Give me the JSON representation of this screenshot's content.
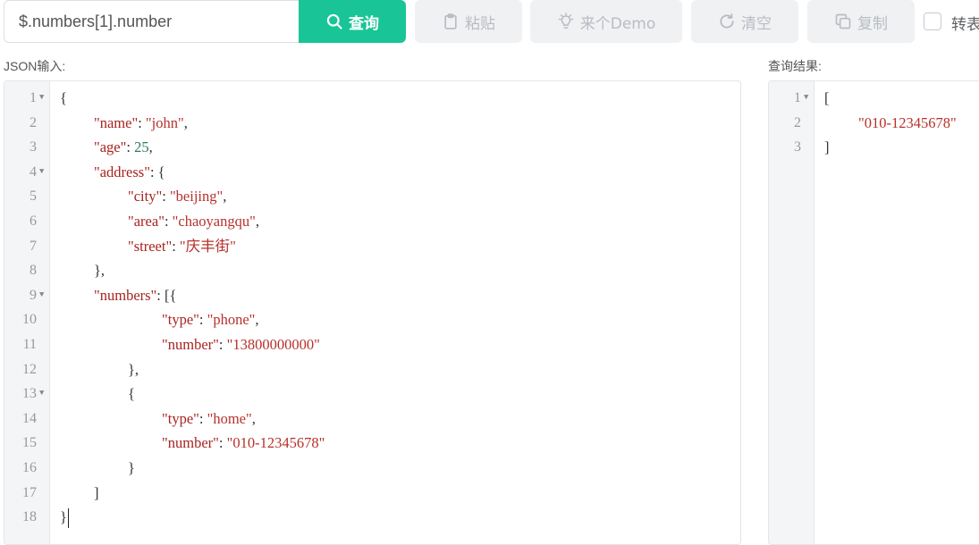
{
  "toolbar": {
    "query_value": "$.numbers[1].number",
    "query_button": "查询",
    "paste_button": "粘贴",
    "demo_button": "来个Demo",
    "clear_button": "清空",
    "copy_button": "复制",
    "escape_label": "转表",
    "escape_checked": false
  },
  "input_panel": {
    "label": "JSON输入:",
    "lines": [
      {
        "n": "1",
        "fold": true,
        "indent": 0,
        "tokens": [
          [
            "p",
            "{"
          ]
        ]
      },
      {
        "n": "2",
        "fold": false,
        "indent": 1,
        "tokens": [
          [
            "k",
            "\"name\""
          ],
          [
            "p",
            ": "
          ],
          [
            "s",
            "\"john\""
          ],
          [
            "p",
            ","
          ]
        ]
      },
      {
        "n": "3",
        "fold": false,
        "indent": 1,
        "tokens": [
          [
            "k",
            "\"age\""
          ],
          [
            "p",
            ": "
          ],
          [
            "n",
            "25"
          ],
          [
            "p",
            ","
          ]
        ]
      },
      {
        "n": "4",
        "fold": true,
        "indent": 1,
        "tokens": [
          [
            "k",
            "\"address\""
          ],
          [
            "p",
            ": {"
          ]
        ]
      },
      {
        "n": "5",
        "fold": false,
        "indent": 2,
        "tokens": [
          [
            "k",
            "\"city\""
          ],
          [
            "p",
            ": "
          ],
          [
            "s",
            "\"beijing\""
          ],
          [
            "p",
            ","
          ]
        ]
      },
      {
        "n": "6",
        "fold": false,
        "indent": 2,
        "tokens": [
          [
            "k",
            "\"area\""
          ],
          [
            "p",
            ": "
          ],
          [
            "s",
            "\"chaoyangqu\""
          ],
          [
            "p",
            ","
          ]
        ]
      },
      {
        "n": "7",
        "fold": false,
        "indent": 2,
        "tokens": [
          [
            "k",
            "\"street\""
          ],
          [
            "p",
            ": "
          ],
          [
            "s",
            "\"庆丰街\""
          ]
        ]
      },
      {
        "n": "8",
        "fold": false,
        "indent": 1,
        "tokens": [
          [
            "p",
            "},"
          ]
        ]
      },
      {
        "n": "9",
        "fold": true,
        "indent": 1,
        "tokens": [
          [
            "k",
            "\"numbers\""
          ],
          [
            "p",
            ": [{"
          ]
        ]
      },
      {
        "n": "10",
        "fold": false,
        "indent": 3,
        "tokens": [
          [
            "k",
            "\"type\""
          ],
          [
            "p",
            ": "
          ],
          [
            "s",
            "\"phone\""
          ],
          [
            "p",
            ","
          ]
        ]
      },
      {
        "n": "11",
        "fold": false,
        "indent": 3,
        "tokens": [
          [
            "k",
            "\"number\""
          ],
          [
            "p",
            ": "
          ],
          [
            "s",
            "\"13800000000\""
          ]
        ]
      },
      {
        "n": "12",
        "fold": false,
        "indent": 2,
        "tokens": [
          [
            "p",
            "},"
          ]
        ]
      },
      {
        "n": "13",
        "fold": true,
        "indent": 2,
        "tokens": [
          [
            "p",
            "{"
          ]
        ]
      },
      {
        "n": "14",
        "fold": false,
        "indent": 3,
        "tokens": [
          [
            "k",
            "\"type\""
          ],
          [
            "p",
            ": "
          ],
          [
            "s",
            "\"home\""
          ],
          [
            "p",
            ","
          ]
        ]
      },
      {
        "n": "15",
        "fold": false,
        "indent": 3,
        "tokens": [
          [
            "k",
            "\"number\""
          ],
          [
            "p",
            ": "
          ],
          [
            "s",
            "\"010-12345678\""
          ]
        ]
      },
      {
        "n": "16",
        "fold": false,
        "indent": 2,
        "tokens": [
          [
            "p",
            "}"
          ]
        ]
      },
      {
        "n": "17",
        "fold": false,
        "indent": 1,
        "tokens": [
          [
            "p",
            "]"
          ]
        ]
      },
      {
        "n": "18",
        "fold": false,
        "indent": 0,
        "cursor": true,
        "tokens": [
          [
            "p",
            "}"
          ]
        ]
      }
    ]
  },
  "result_panel": {
    "label": "查询结果:",
    "lines": [
      {
        "n": "1",
        "fold": true,
        "indent": 0,
        "tokens": [
          [
            "p",
            "["
          ]
        ]
      },
      {
        "n": "2",
        "fold": false,
        "indent": 1,
        "tokens": [
          [
            "s",
            "\"010-12345678\""
          ]
        ]
      },
      {
        "n": "3",
        "fold": false,
        "indent": 0,
        "tokens": [
          [
            "p",
            "]"
          ]
        ]
      }
    ]
  },
  "colors": {
    "accent": "#19c596",
    "key": "#a8231f",
    "string": "#b7312c",
    "number": "#2c7a5a"
  }
}
